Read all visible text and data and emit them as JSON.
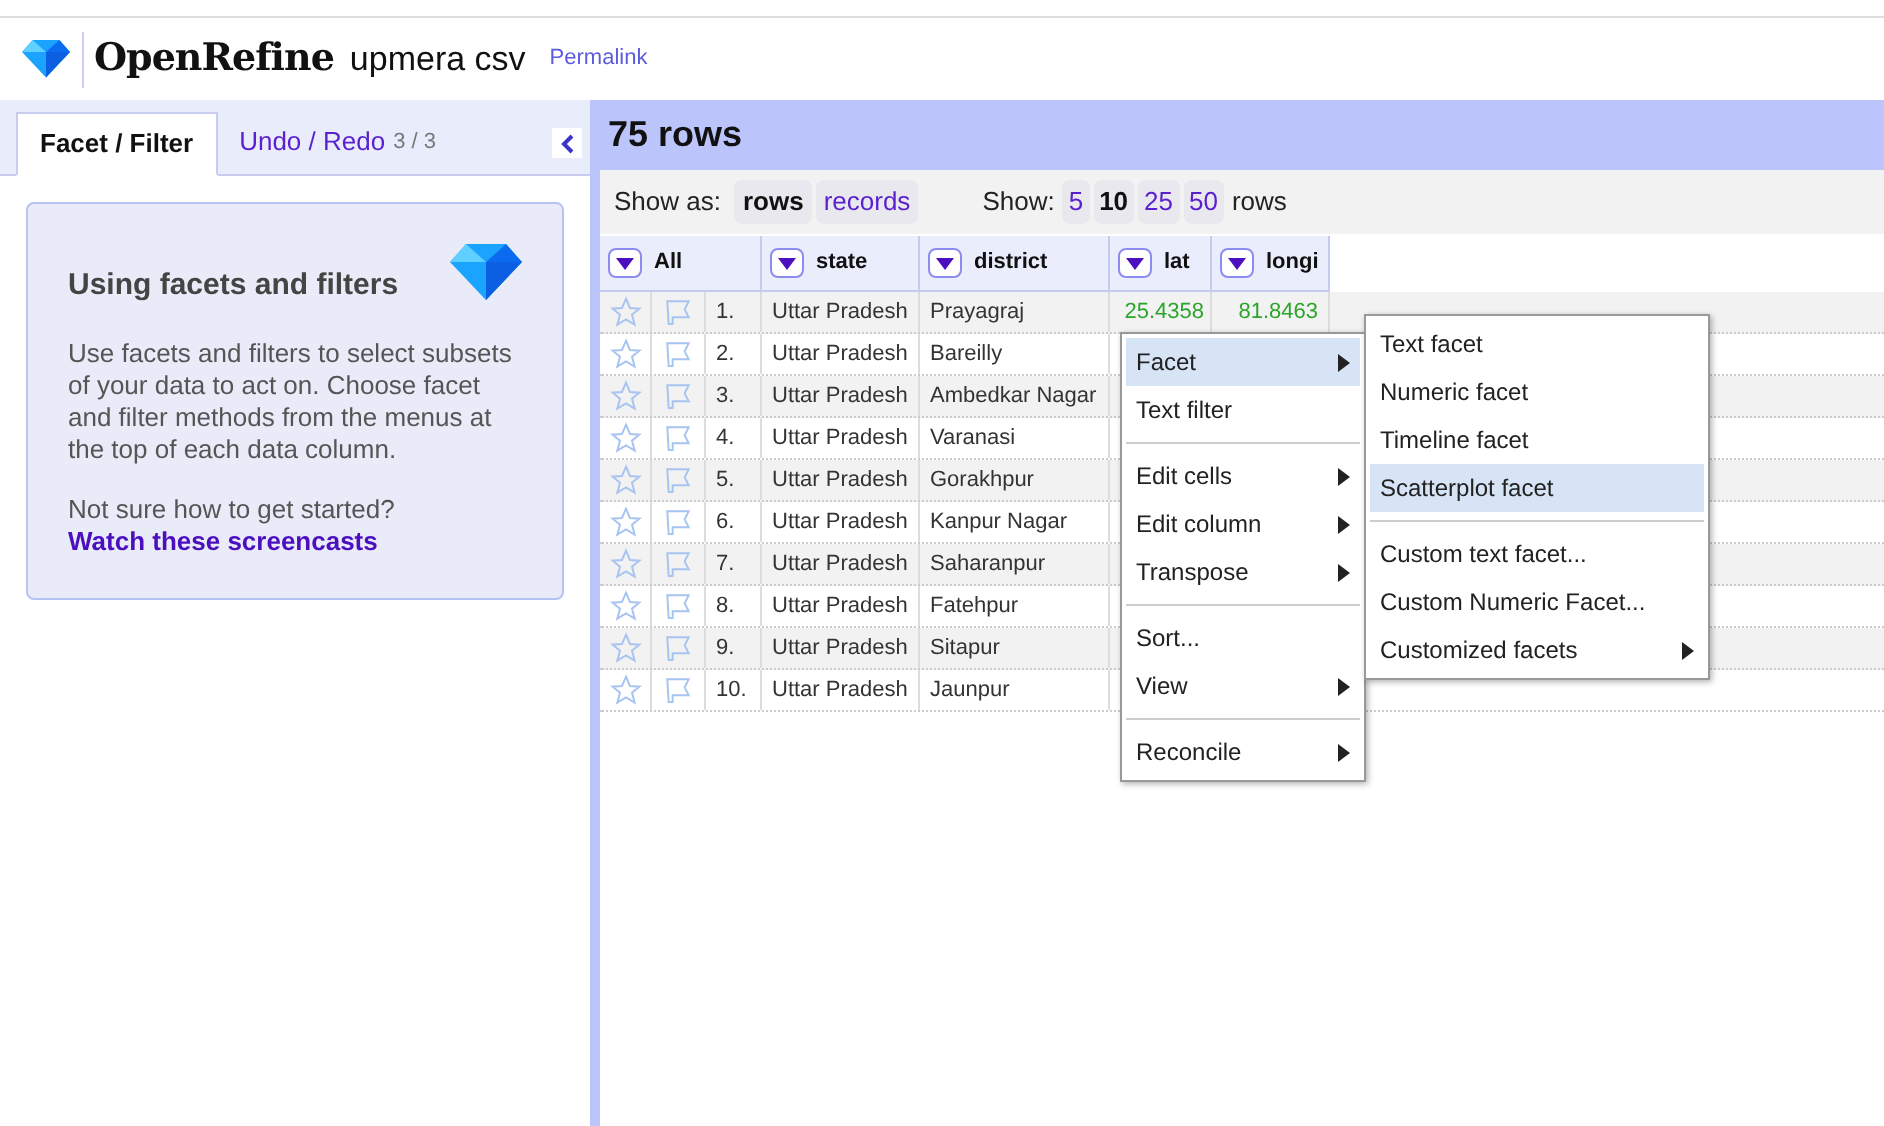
{
  "header": {
    "app_name": "OpenRefine",
    "project_name": "upmera csv",
    "permalink": "Permalink"
  },
  "left_panel": {
    "tabs": [
      {
        "label": "Facet / Filter",
        "selected": true
      },
      {
        "label": "Undo / Redo",
        "count": "3 / 3",
        "selected": false
      }
    ],
    "help": {
      "title": "Using facets and filters",
      "body": "Use facets and filters to select subsets of your data to act on. Choose facet and filter methods from the menus at the top of each data column.",
      "question": "Not sure how to get started?",
      "link": "Watch these screencasts"
    }
  },
  "grid": {
    "row_count": "75 rows",
    "show_as_label": "Show as:",
    "show_as": [
      {
        "label": "rows",
        "selected": true
      },
      {
        "label": "records",
        "selected": false
      }
    ],
    "show_label": "Show:",
    "page_sizes": [
      {
        "label": "5",
        "selected": false
      },
      {
        "label": "10",
        "selected": true
      },
      {
        "label": "25",
        "selected": false
      },
      {
        "label": "50",
        "selected": false
      }
    ],
    "page_suffix": "rows",
    "columns": [
      "All",
      "state",
      "district",
      "lat",
      "longi"
    ],
    "rows": [
      {
        "index": "1.",
        "state": "Uttar Pradesh",
        "district": "Prayagraj",
        "lat": "25.4358",
        "longi": "81.8463"
      },
      {
        "index": "2.",
        "state": "Uttar Pradesh",
        "district": "Bareilly"
      },
      {
        "index": "3.",
        "state": "Uttar Pradesh",
        "district": "Ambedkar Nagar"
      },
      {
        "index": "4.",
        "state": "Uttar Pradesh",
        "district": "Varanasi"
      },
      {
        "index": "5.",
        "state": "Uttar Pradesh",
        "district": "Gorakhpur"
      },
      {
        "index": "6.",
        "state": "Uttar Pradesh",
        "district": "Kanpur Nagar"
      },
      {
        "index": "7.",
        "state": "Uttar Pradesh",
        "district": "Saharanpur"
      },
      {
        "index": "8.",
        "state": "Uttar Pradesh",
        "district": "Fatehpur"
      },
      {
        "index": "9.",
        "state": "Uttar Pradesh",
        "district": "Sitapur"
      },
      {
        "index": "10.",
        "state": "Uttar Pradesh",
        "district": "Jaunpur"
      }
    ]
  },
  "column_menu": [
    {
      "kind": "item",
      "label": "Facet",
      "submenu": true,
      "selected": true
    },
    {
      "kind": "item",
      "label": "Text filter",
      "submenu": false,
      "selected": false
    },
    {
      "kind": "separator"
    },
    {
      "kind": "item",
      "label": "Edit cells",
      "submenu": true,
      "selected": false
    },
    {
      "kind": "item",
      "label": "Edit column",
      "submenu": true,
      "selected": false
    },
    {
      "kind": "item",
      "label": "Transpose",
      "submenu": true,
      "selected": false
    },
    {
      "kind": "separator"
    },
    {
      "kind": "item",
      "label": "Sort...",
      "submenu": false,
      "selected": false
    },
    {
      "kind": "item",
      "label": "View",
      "submenu": true,
      "selected": false
    },
    {
      "kind": "separator"
    },
    {
      "kind": "item",
      "label": "Reconcile",
      "submenu": true,
      "selected": false
    }
  ],
  "facet_submenu": [
    {
      "kind": "item",
      "label": "Text facet",
      "submenu": false,
      "selected": false
    },
    {
      "kind": "item",
      "label": "Numeric facet",
      "submenu": false,
      "selected": false
    },
    {
      "kind": "item",
      "label": "Timeline facet",
      "submenu": false,
      "selected": false
    },
    {
      "kind": "item",
      "label": "Scatterplot facet",
      "submenu": false,
      "selected": true
    },
    {
      "kind": "separator"
    },
    {
      "kind": "item",
      "label": "Custom text facet...",
      "submenu": false,
      "selected": false
    },
    {
      "kind": "item",
      "label": "Custom Numeric Facet...",
      "submenu": false,
      "selected": false
    },
    {
      "kind": "item",
      "label": "Customized facets",
      "submenu": true,
      "selected": false
    }
  ]
}
